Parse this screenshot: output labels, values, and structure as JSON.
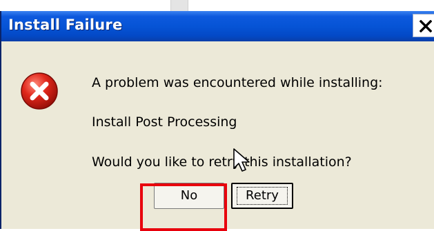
{
  "dialog": {
    "title": "Install Failure",
    "messages": {
      "line1": "A problem was encountered while installing:",
      "line2": "Install Post Processing",
      "line3": "Would you like to retry this installation?"
    },
    "buttons": {
      "no_label": "No",
      "retry_label": "Retry"
    },
    "icons": {
      "status": "error-icon",
      "close": "close-icon",
      "pointer": "cursor-icon"
    }
  },
  "colors": {
    "titlebar": "#0654d6",
    "dialog_background": "#ece9d8",
    "highlight": "#e8000c"
  }
}
